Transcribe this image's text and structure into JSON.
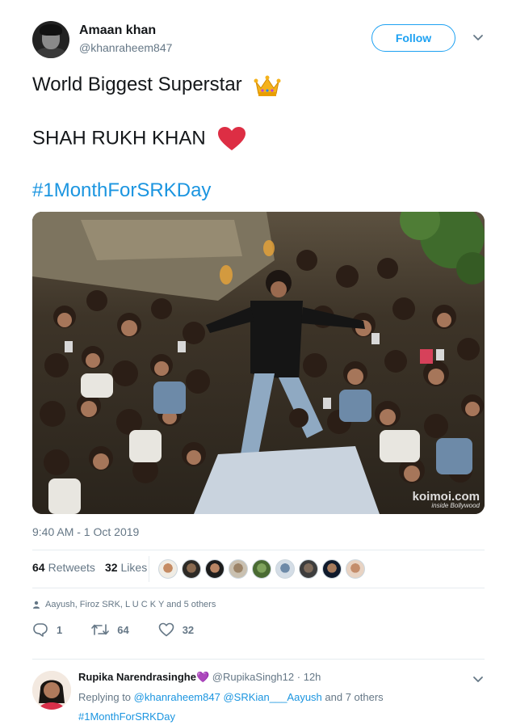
{
  "author": {
    "name": "Amaan khan",
    "handle": "@khanraheem847",
    "follow_label": "Follow"
  },
  "tweet": {
    "line1": "World Biggest Superstar",
    "line2": "SHAH RUKH KHAN",
    "hashtag": "#1MonthForSRKDay",
    "timestamp": "9:40 AM - 1 Oct 2019"
  },
  "photo": {
    "watermark_brand": "koimoi.com",
    "watermark_sub": "inside Bollywood"
  },
  "stats": {
    "retweets_count": "64",
    "retweets_label": "Retweets",
    "likes_count": "32",
    "likes_label": "Likes"
  },
  "liked_by": "Aayush, Firoz SRK, L U C K Y and 5 others",
  "actions": {
    "reply_count": "1",
    "retweet_count": "64",
    "like_count": "32"
  },
  "reply": {
    "name": "Rupika Narendrasinghe",
    "emoji": "💜",
    "handle": "@RupikaSingh12",
    "separator": "·",
    "time": "12h",
    "replying_prefix": "Replying to",
    "mention1": "@khanraheem847",
    "mention2": "@SRKian___Aayush",
    "others": "and 7 others",
    "hashtag": "#1MonthForSRKDay"
  },
  "colors": {
    "accent": "#1da1f2",
    "link": "#1b95e0",
    "muted": "#657786",
    "heart": "#e0245e"
  },
  "icons": [
    "chevron-down-icon",
    "crown-icon",
    "heart-emoji-icon",
    "person-icon",
    "reply-icon",
    "retweet-icon",
    "like-icon"
  ]
}
